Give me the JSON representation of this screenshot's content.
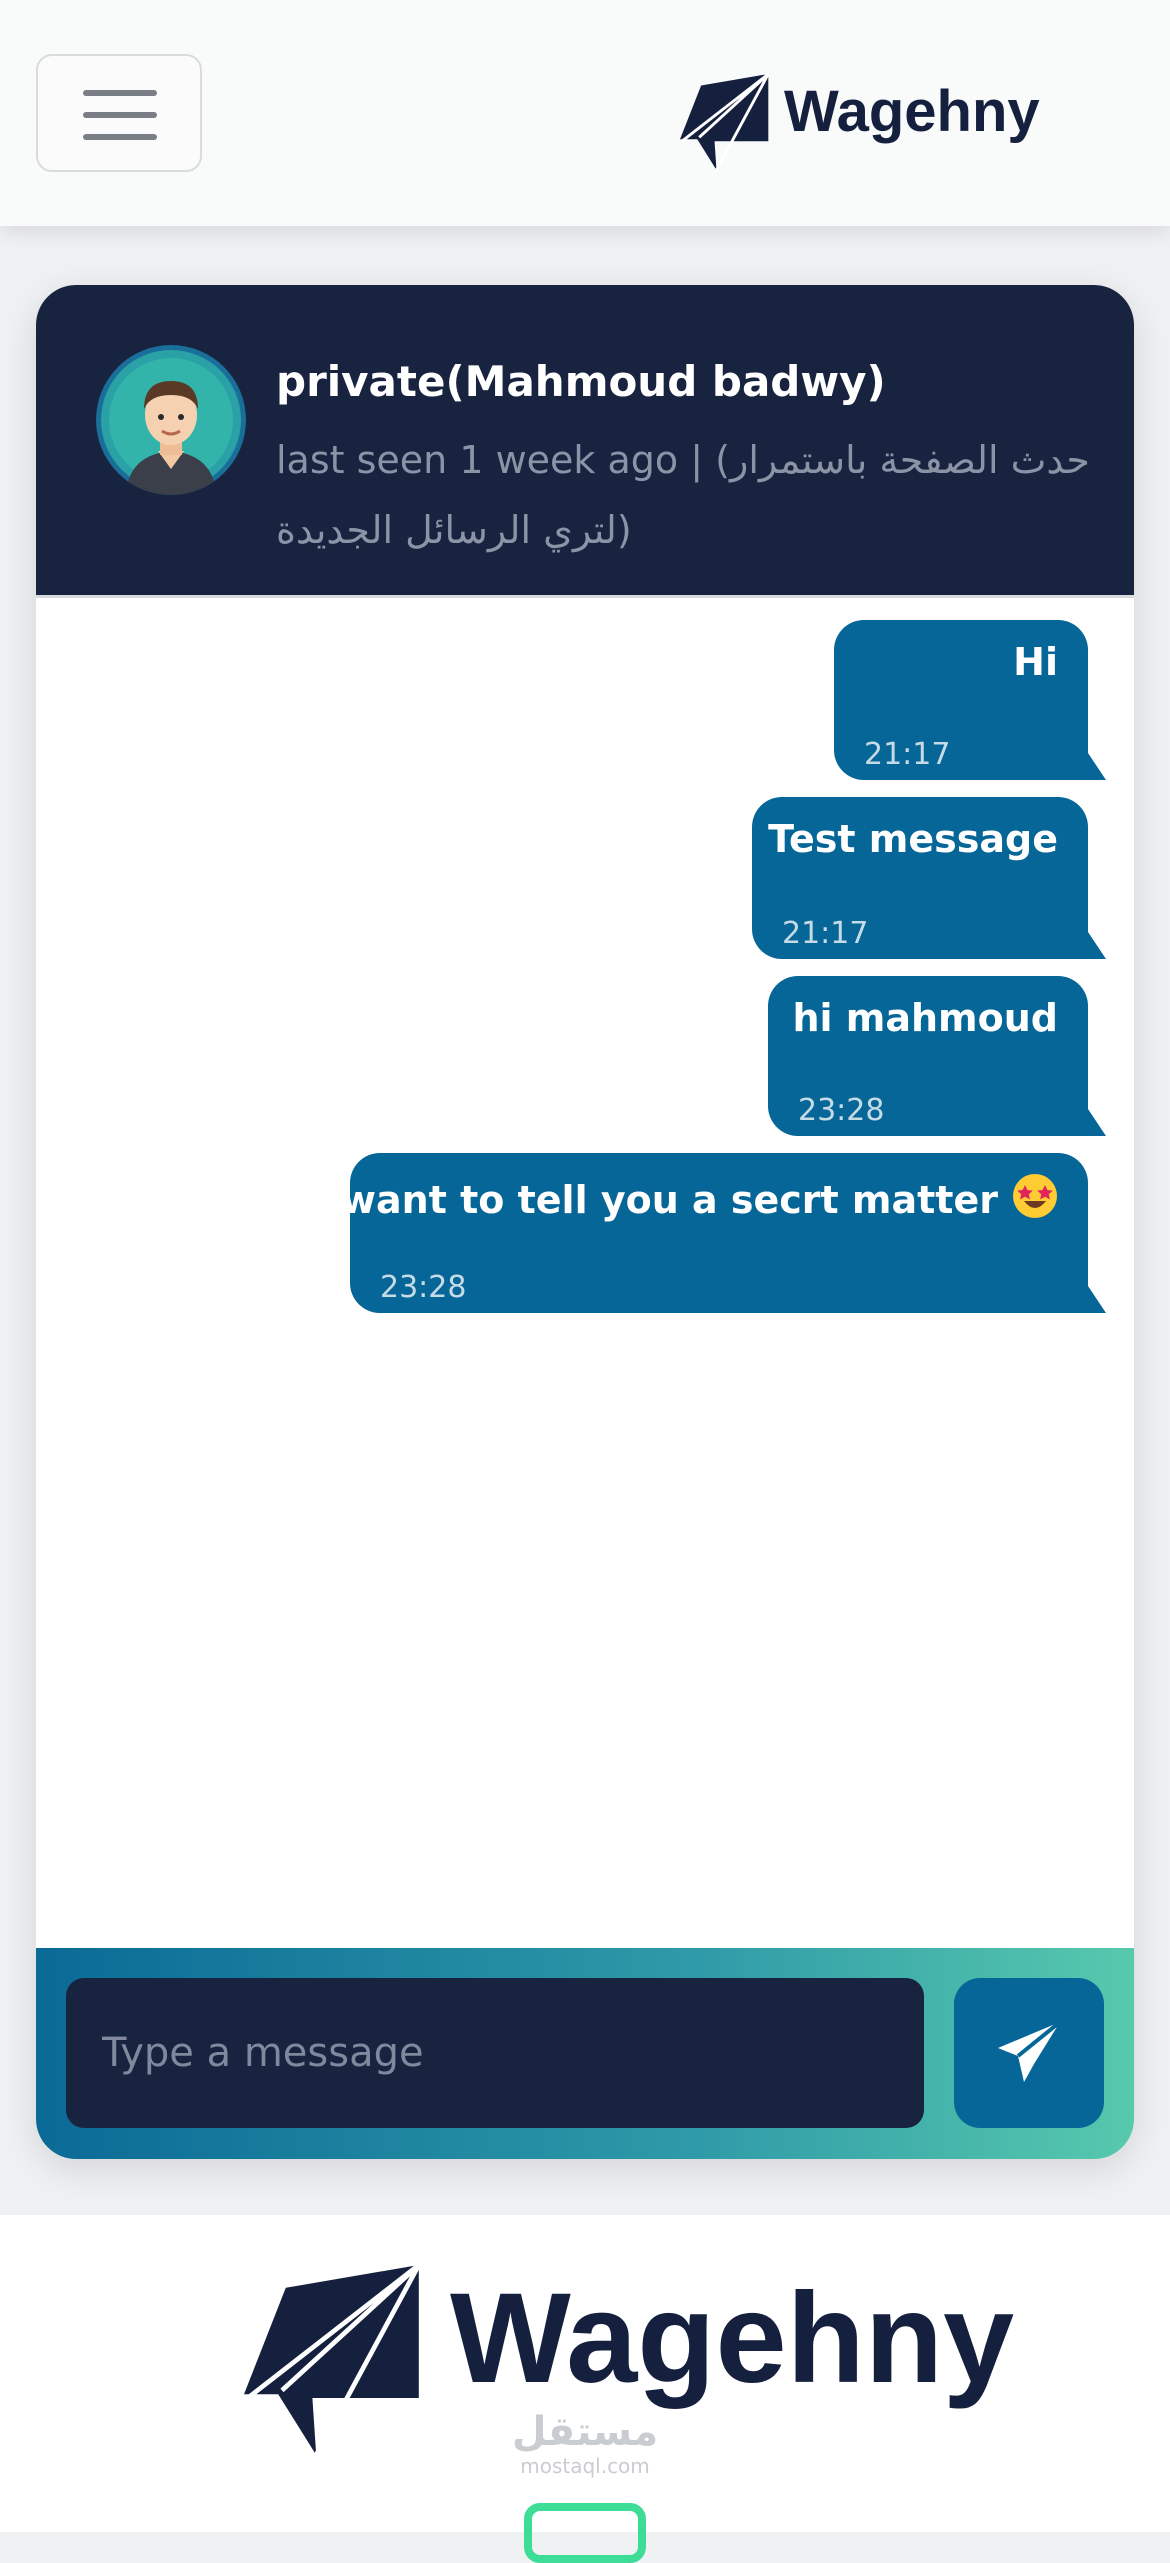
{
  "navbar": {
    "menu_icon": "hamburger-menu-icon",
    "brand": "Wagehny",
    "logo_icon": "paper-plane-logo-icon"
  },
  "chat": {
    "contact_name": "private(Mahmoud badwy)",
    "status_text": "last seen 1 week ago | (حدث الصفحة باستمرار لتري الرسائل الجديدة)",
    "avatar_icon": "user-avatar-icon",
    "messages": [
      {
        "text": "Hi",
        "time": "21:17"
      },
      {
        "text": "Test message",
        "time": "21:17"
      },
      {
        "text": "hi mahmoud",
        "time": "23:28"
      },
      {
        "text": "i want to tell you a secrt matter",
        "time": "23:28",
        "emoji": "star-struck-emoji-icon"
      }
    ],
    "composer": {
      "placeholder": "Type a message",
      "send_icon": "paper-plane-send-icon"
    }
  },
  "footer": {
    "brand": "Wagehny",
    "watermark_arabic": "مستقل",
    "watermark_url": "mostaql.com"
  },
  "colors": {
    "navy": "#18233f",
    "bubble_blue": "#056697",
    "teal_accent": "#57c9ad",
    "badge_green": "#3ddc97"
  }
}
